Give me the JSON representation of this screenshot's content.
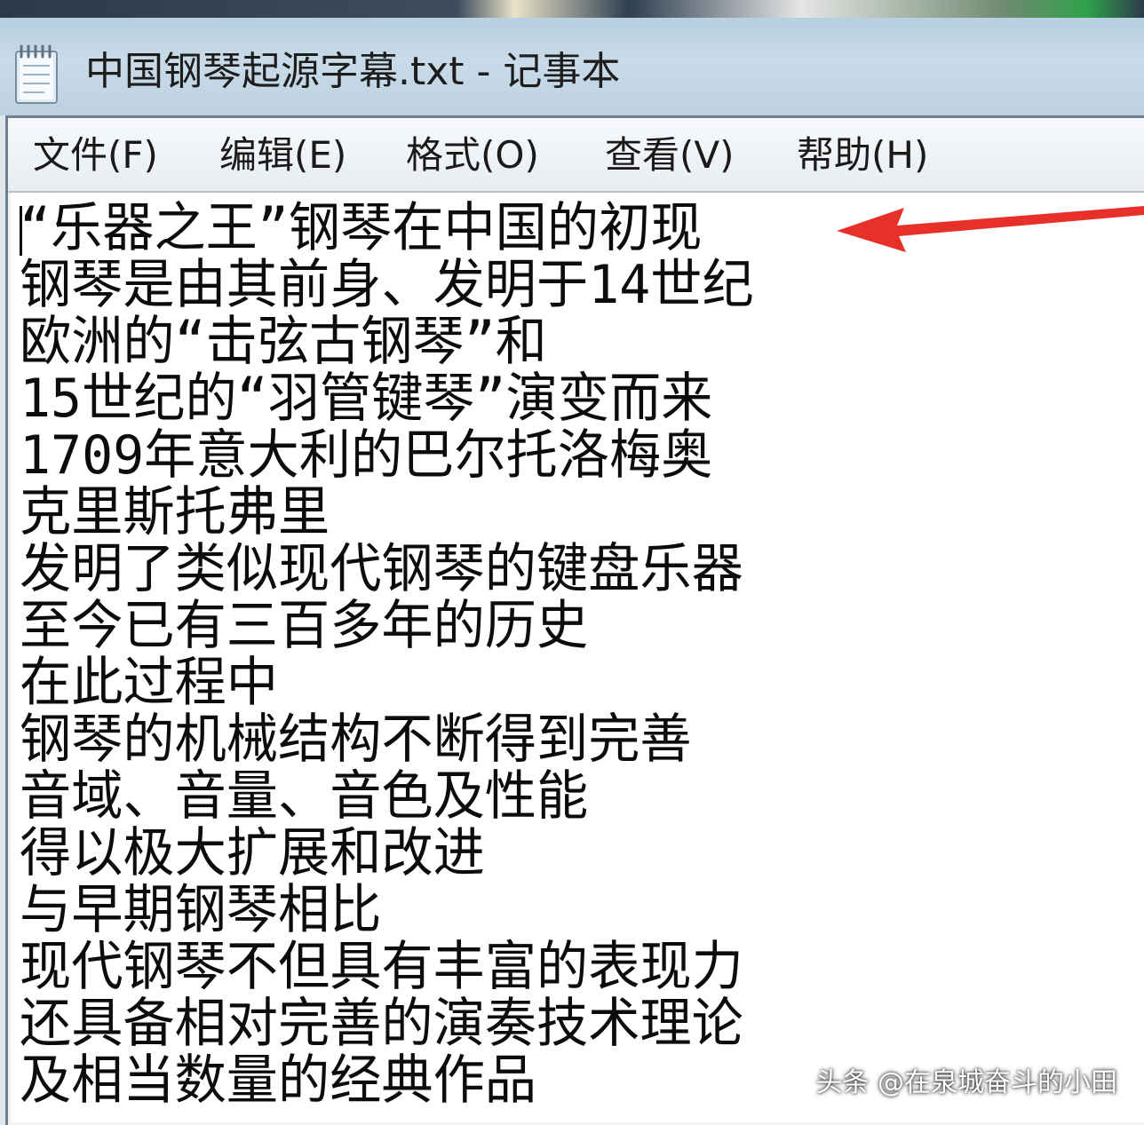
{
  "window": {
    "title": "中国钢琴起源字幕.txt - 记事本"
  },
  "menu": {
    "items": [
      "文件(F)",
      "编辑(E)",
      "格式(O)",
      "查看(V)",
      "帮助(H)"
    ]
  },
  "editor": {
    "lines": [
      "“乐器之王”钢琴在中国的初现",
      "钢琴是由其前身、发明于14世纪",
      "欧洲的“击弦古钢琴”和",
      "15世纪的“羽管键琴”演变而来",
      "1709年意大利的巴尔托洛梅奥",
      "克里斯托弗里",
      "发明了类似现代钢琴的键盘乐器",
      "至今已有三百多年的历史",
      "在此过程中",
      "钢琴的机械结构不断得到完善",
      "音域、音量、音色及性能",
      "得以极大扩展和改进",
      "与早期钢琴相比",
      "现代钢琴不但具有丰富的表现力",
      "还具备相对完善的演奏技术理论",
      "及相当数量的经典作品"
    ]
  },
  "watermark": {
    "text": "头条 @在泉城奋斗的小田"
  },
  "colors": {
    "arrow": "#e8302a",
    "titlebar": "#c4d7e6",
    "editor_bg": "#ffffff"
  },
  "icons": {
    "app": "notepad-icon",
    "annotation": "red-arrow-icon"
  }
}
